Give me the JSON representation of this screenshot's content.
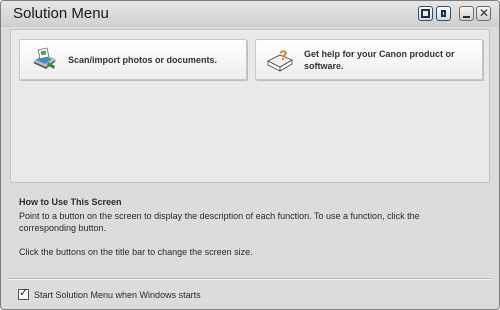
{
  "window": {
    "title": "Solution Menu"
  },
  "titlebar_buttons": {
    "full_screen": "full-screen-icon",
    "small_screen": "small-screen-icon",
    "minimize": "minimize-icon",
    "close": "close-icon"
  },
  "menu_buttons": [
    {
      "label": "Scan/import photos or documents.",
      "icon": "scanner-icon"
    },
    {
      "label": "Get help for your Canon product or software.",
      "icon": "help-book-icon"
    }
  ],
  "help": {
    "heading": "How to Use This Screen",
    "line1": "Point to a button on the screen to display the description of each function. To use a function, click the",
    "line2": "corresponding button.",
    "line3": "Click the buttons on the title bar to change the screen size."
  },
  "startup_option": {
    "label": "Start Solution Menu when Windows starts",
    "checked": true
  },
  "colors": {
    "window_bg": "#dcdcdc",
    "panel_bg": "#e9e9e9",
    "titlebar_button_border": "#2f4e6f"
  }
}
